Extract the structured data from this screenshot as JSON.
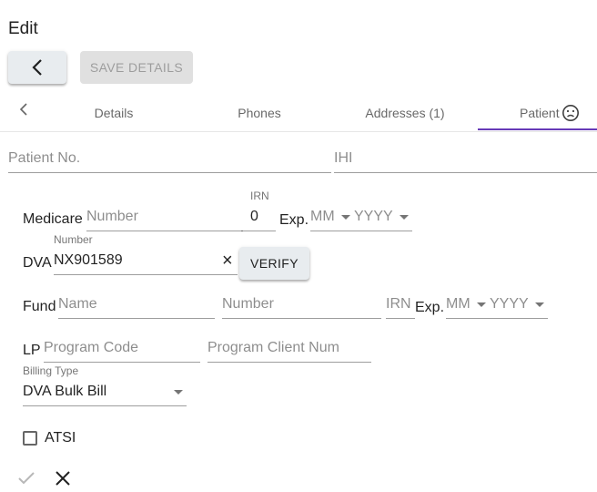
{
  "header": {
    "title": "Edit",
    "save_label": "SAVE DETAILS"
  },
  "tabs": [
    {
      "label": "Details"
    },
    {
      "label": "Phones"
    },
    {
      "label": "Addresses (1)"
    },
    {
      "label": "Patient"
    }
  ],
  "patient": {
    "patient_no_placeholder": "Patient No.",
    "ihi_placeholder": "IHI"
  },
  "medicare": {
    "label": "Medicare",
    "number_placeholder": "Number",
    "irn_label": "IRN",
    "irn_value": "0",
    "exp_label": "Exp.",
    "month_placeholder": "MM",
    "year_placeholder": "YYYY"
  },
  "dva": {
    "label": "DVA",
    "number_label": "Number",
    "number_value": "NX901589",
    "clear_glyph": "×",
    "verify_label": "VERIFY"
  },
  "fund": {
    "label": "Fund",
    "name_placeholder": "Name",
    "number_placeholder": "Number",
    "irn_placeholder": "IRN",
    "exp_label": "Exp.",
    "month_placeholder": "MM",
    "year_placeholder": "YYYY"
  },
  "lp": {
    "label": "LP",
    "program_code_placeholder": "Program Code",
    "program_client_placeholder": "Program Client Num"
  },
  "billing": {
    "label": "Billing Type",
    "value": "DVA Bulk Bill"
  },
  "atsi": {
    "label": "ATSI",
    "checked": false
  },
  "colors": {
    "accent": "#673ab7",
    "button_bg": "#e8ecef",
    "disabled_bg": "#e0e0e0"
  }
}
